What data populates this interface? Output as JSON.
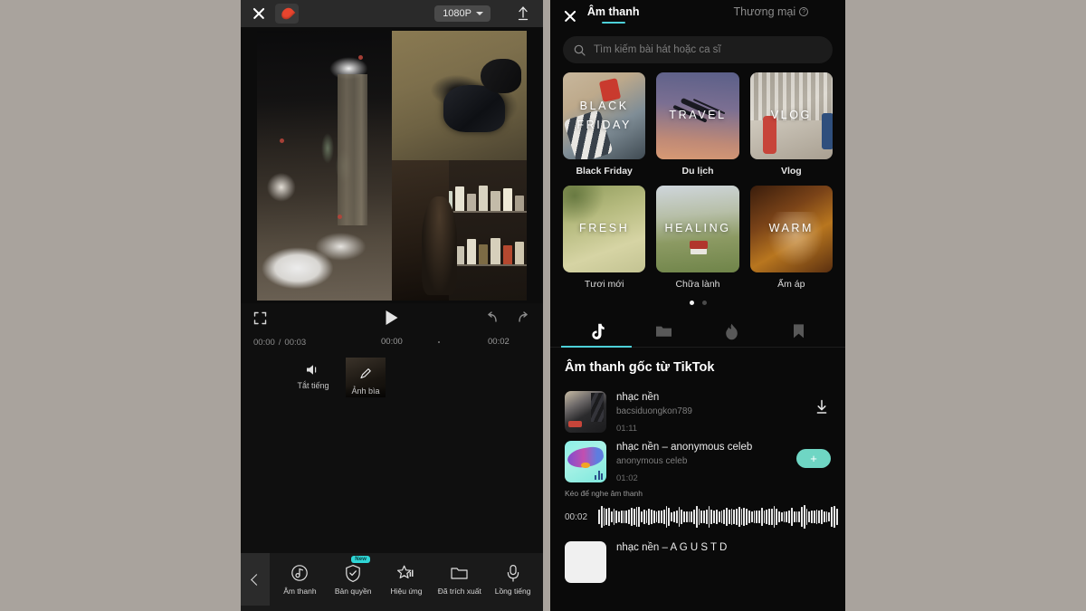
{
  "editor": {
    "topbar": {
      "close_icon": "close-icon",
      "flame_icon": "flame-icon",
      "resolution": "1080P",
      "upload_icon": "upload-icon"
    },
    "playbar": {
      "expand_icon": "expand-icon",
      "play_icon": "play-icon",
      "undo_icon": "undo-icon",
      "redo_icon": "redo-icon"
    },
    "timeline": {
      "current_time": "00:00",
      "separator": "/",
      "total_time": "00:03",
      "ruler": [
        "00:00",
        "00:02"
      ],
      "mute_label": "Tắt tiếng",
      "cover_label": "Ảnh bìa",
      "add_small": "+",
      "add_button": "+"
    },
    "tools": [
      {
        "label": "Âm thanh",
        "icon": "music-note-icon",
        "badge": null
      },
      {
        "label": "Bản quyền",
        "icon": "shield-check-icon",
        "badge": "New"
      },
      {
        "label": "Hiệu ứng",
        "icon": "star-effect-icon",
        "badge": null
      },
      {
        "label": "Đã trích xuất",
        "icon": "folder-icon",
        "badge": null
      },
      {
        "label": "Lồng tiếng",
        "icon": "microphone-icon",
        "badge": null
      }
    ],
    "back_icon": "chevron-left-icon"
  },
  "sound_panel": {
    "close_icon": "close-icon",
    "tabs": [
      {
        "label": "Âm thanh",
        "active": true
      },
      {
        "label": "Thương mại",
        "active": false,
        "help_icon": "question-mark-icon"
      }
    ],
    "search": {
      "placeholder": "Tìm kiếm bài hát hoặc ca sĩ",
      "icon": "search-icon"
    },
    "categories": [
      {
        "overlay": "BLACK FRIDAY",
        "caption": "Black Friday",
        "theme": "bf"
      },
      {
        "overlay": "TRAVEL",
        "caption": "Du lịch",
        "theme": "tv"
      },
      {
        "overlay": "VLOG",
        "caption": "Vlog",
        "theme": "vl"
      },
      {
        "overlay": "FRESH",
        "caption": "Tươi mới",
        "theme": "fr"
      },
      {
        "overlay": "HEALING",
        "caption": "Chữa lành",
        "theme": "hl"
      },
      {
        "overlay": "WARM",
        "caption": "Ấm áp",
        "theme": "wm"
      }
    ],
    "pagination": {
      "total": 2,
      "active": 0
    },
    "icon_tabs": [
      {
        "icon": "tiktok-icon",
        "active": true
      },
      {
        "icon": "folder-icon",
        "active": false
      },
      {
        "icon": "flame-icon",
        "active": false
      },
      {
        "icon": "bookmark-icon",
        "active": false
      }
    ],
    "section_title": "Âm thanh gốc từ TikTok",
    "songs": [
      {
        "title": "nhạc nền",
        "artist": "bacsiduongkon789",
        "duration": "01:11",
        "action": "download-icon"
      },
      {
        "title": "nhạc nền – anonymous celeb",
        "artist": "anonymous celeb",
        "duration": "01:02",
        "action": "add-button"
      }
    ],
    "drag_hint": "Kéo để nghe âm thanh",
    "waveform_time": "00:02",
    "partial_song": {
      "title": "nhạc nền – A G U S T D"
    },
    "accent_color": "#4dd0d8",
    "add_button_color": "#6fd6c4"
  }
}
